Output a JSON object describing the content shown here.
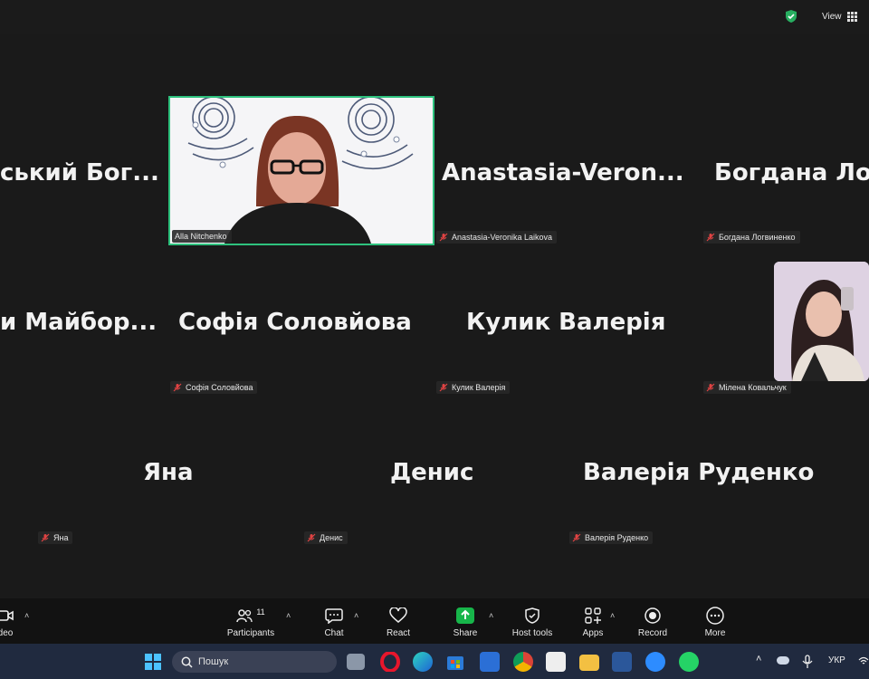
{
  "topbar": {
    "view_label": "View"
  },
  "tiles": [
    {
      "name": "ський  Бог...",
      "label": ""
    },
    {
      "name": "",
      "label": "Alla Nitchenko"
    },
    {
      "name": "Anastasia-Veron...",
      "label": "Anastasia-Veronika Laikova"
    },
    {
      "name": "Богдана  Ло",
      "label": "Богдана Логвиненко"
    },
    {
      "name": "и  Майбор...",
      "label": ""
    },
    {
      "name": "Софія Соловйова",
      "label": "Софія Соловйова"
    },
    {
      "name": "Кулик Валерія",
      "label": "Кулик Валерія"
    },
    {
      "name": "",
      "label": "Мілена Ковальчук"
    },
    {
      "name": "Яна",
      "label": "Яна"
    },
    {
      "name": "Денис",
      "label": "Денис"
    },
    {
      "name": "Валерія Руденко",
      "label": "Валерія Руденко"
    }
  ],
  "toolbar": {
    "video_label": "deo",
    "participants_label": "Participants",
    "participants_count": "11",
    "chat_label": "Chat",
    "react_label": "React",
    "share_label": "Share",
    "host_label": "Host tools",
    "apps_label": "Apps",
    "record_label": "Record",
    "more_label": "More"
  },
  "taskbar": {
    "search_placeholder": "Пошук",
    "lang": "УКР"
  },
  "colors": {
    "active_speaker": "#2ec27e",
    "bg": "#1a1a1a",
    "share_green": "#17b54a"
  }
}
